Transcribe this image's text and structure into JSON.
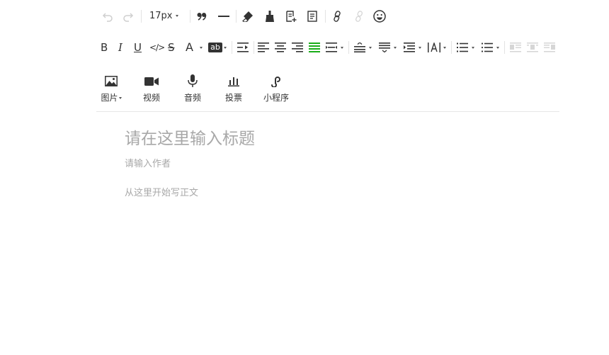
{
  "toolbar_row1": {
    "font_size": "17px",
    "icons": [
      "undo-icon",
      "redo-icon",
      "quote-icon",
      "horizontal-rule-icon",
      "eraser-icon",
      "format-brush-icon",
      "insert-template-icon",
      "template-icon",
      "link-icon",
      "unlink-icon",
      "emoji-icon"
    ]
  },
  "toolbar_row2": {
    "bold": "B",
    "italic": "I",
    "underline": "U",
    "code": "</>",
    "strike": "S",
    "font_color": "A",
    "bg_color": "ab",
    "active_color": "#1aad19"
  },
  "media": [
    {
      "label": "图片",
      "icon": "image-icon"
    },
    {
      "label": "视频",
      "icon": "video-icon"
    },
    {
      "label": "音频",
      "icon": "audio-icon"
    },
    {
      "label": "投票",
      "icon": "vote-icon"
    },
    {
      "label": "小程序",
      "icon": "mini-program-icon"
    }
  ],
  "editor": {
    "title_placeholder": "请在这里输入标题",
    "author_placeholder": "请输入作者",
    "body_placeholder": "从这里开始写正文"
  }
}
